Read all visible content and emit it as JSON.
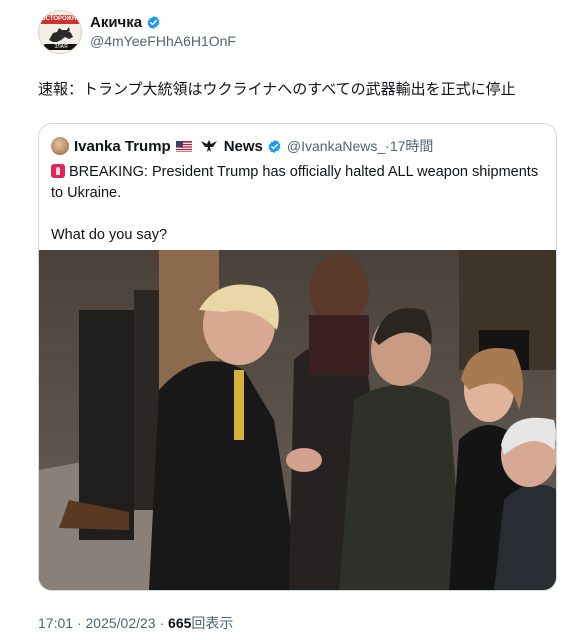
{
  "author": {
    "display_name": "Акичка",
    "handle": "@4mYeeFHhA6H1OnF",
    "avatar_top_text": "ОСТОРОЖНО",
    "avatar_bottom_text": "ЗЛАЯ СОБАКА",
    "verified": true
  },
  "tweet": {
    "text": "速報：トランプ大統領はウクライナへのすべての武器輸出を正式に停止"
  },
  "quote": {
    "display_name": "Ivanka Trump",
    "flag_icon": "us-flag-icon",
    "extra_icon": "eagle-icon",
    "news_label": "News",
    "handle": "@IvankaNews_",
    "separator": "·",
    "time": "17時間",
    "body_line": "BREAKING: President Trump has officially halted ALL weapon shipments to Ukraine.",
    "question": "What do you say?",
    "media": "photo"
  },
  "footer": {
    "time": "17:01",
    "separator": "·",
    "date": "2025/02/23",
    "separator2": "·",
    "views": "665",
    "views_label": "回表示"
  },
  "colors": {
    "verified": "#1d9bf0",
    "text": "#0f1419",
    "muted": "#536471",
    "border": "#cfd9de"
  }
}
